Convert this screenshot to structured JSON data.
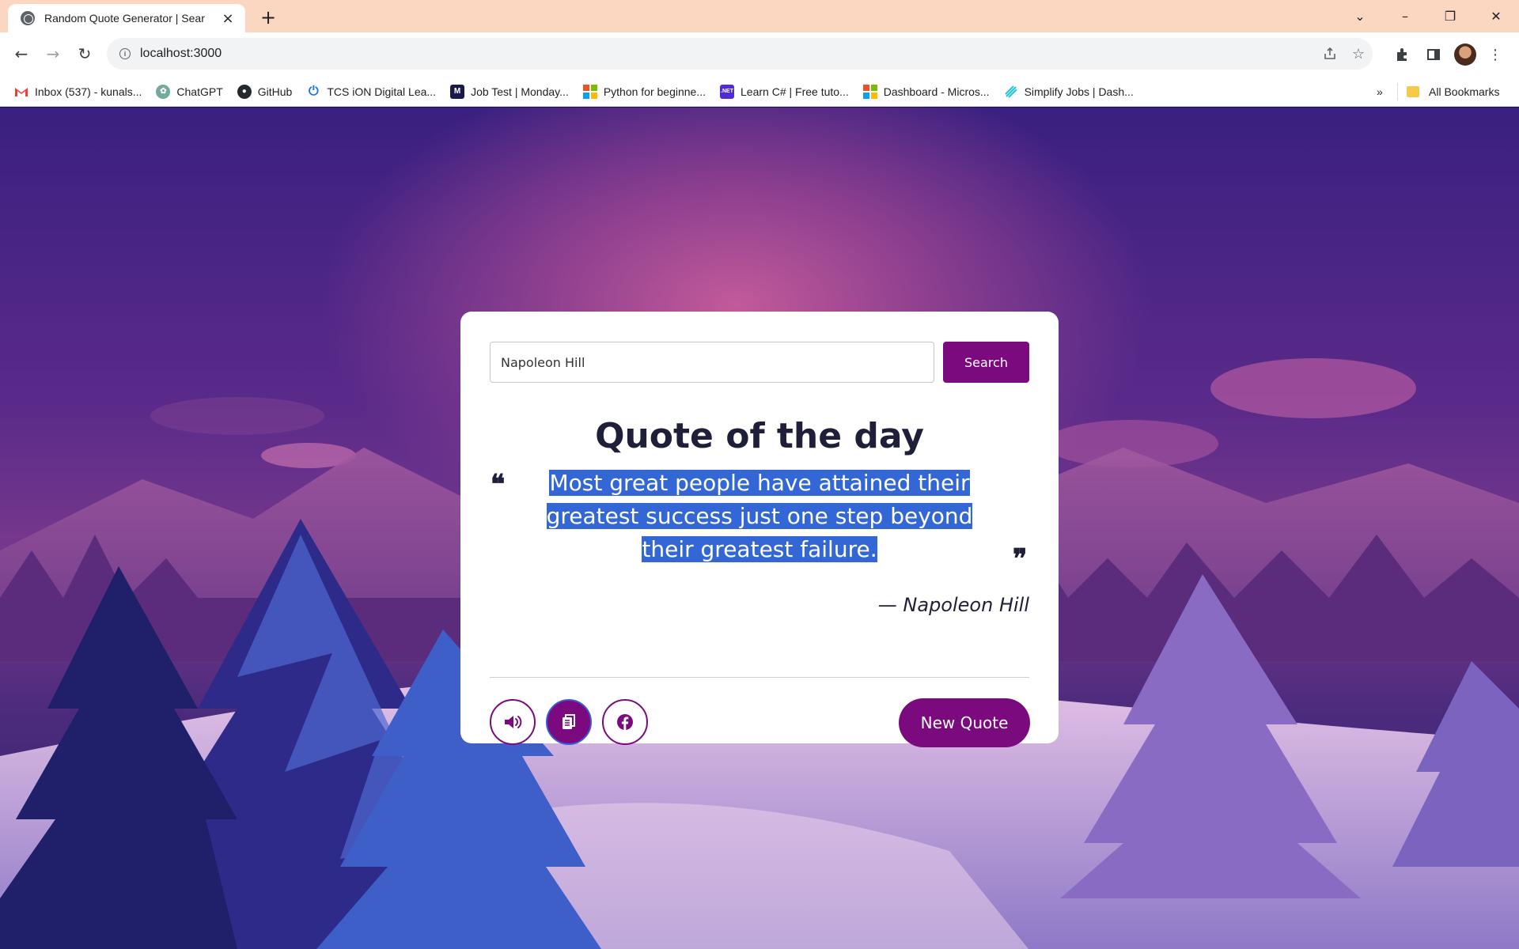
{
  "browser": {
    "tab_title": "Random Quote Generator | Sear",
    "new_tab_symbol": "+",
    "url": "localhost:3000",
    "bookmarks": [
      {
        "label": "Inbox (537) - kunals...",
        "icon": "gmail-icon",
        "color": "#ea4335"
      },
      {
        "label": "ChatGPT",
        "icon": "chatgpt-icon",
        "color": "#74aa9c"
      },
      {
        "label": "GitHub",
        "icon": "github-icon",
        "color": "#24292e"
      },
      {
        "label": "TCS iON Digital Lea...",
        "icon": "power-icon",
        "color": "#1a73e8"
      },
      {
        "label": "Job Test | Monday...",
        "icon": "m-icon",
        "color": "#1a1a4a"
      },
      {
        "label": "Python for beginne...",
        "icon": "microsoft-icon",
        "color": "#f25022"
      },
      {
        "label": "Learn C# | Free tuto...",
        "icon": "dotnet-icon",
        "color": "#512bd4"
      },
      {
        "label": "Dashboard - Micros...",
        "icon": "microsoft-icon",
        "color": "#f25022"
      },
      {
        "label": "Simplify Jobs | Dash...",
        "icon": "simplify-icon",
        "color": "#20c4d4"
      }
    ],
    "more_bookmarks_symbol": "»",
    "all_bookmarks_label": "All Bookmarks"
  },
  "app": {
    "search": {
      "value": "Napoleon Hill",
      "button_label": "Search"
    },
    "heading": "Quote of the day",
    "quote": "Most great people have attained their greatest success just one step beyond their greatest failure.",
    "author": "— Napoleon Hill",
    "new_quote_label": "New Quote",
    "actions": [
      {
        "name": "speak-button",
        "icon": "speaker-icon"
      },
      {
        "name": "copy-button",
        "icon": "copy-icon"
      },
      {
        "name": "facebook-share-button",
        "icon": "facebook-icon"
      }
    ],
    "colors": {
      "accent": "#7a0a7d",
      "selection": "#3367d6",
      "text": "#1f1f3a"
    }
  }
}
